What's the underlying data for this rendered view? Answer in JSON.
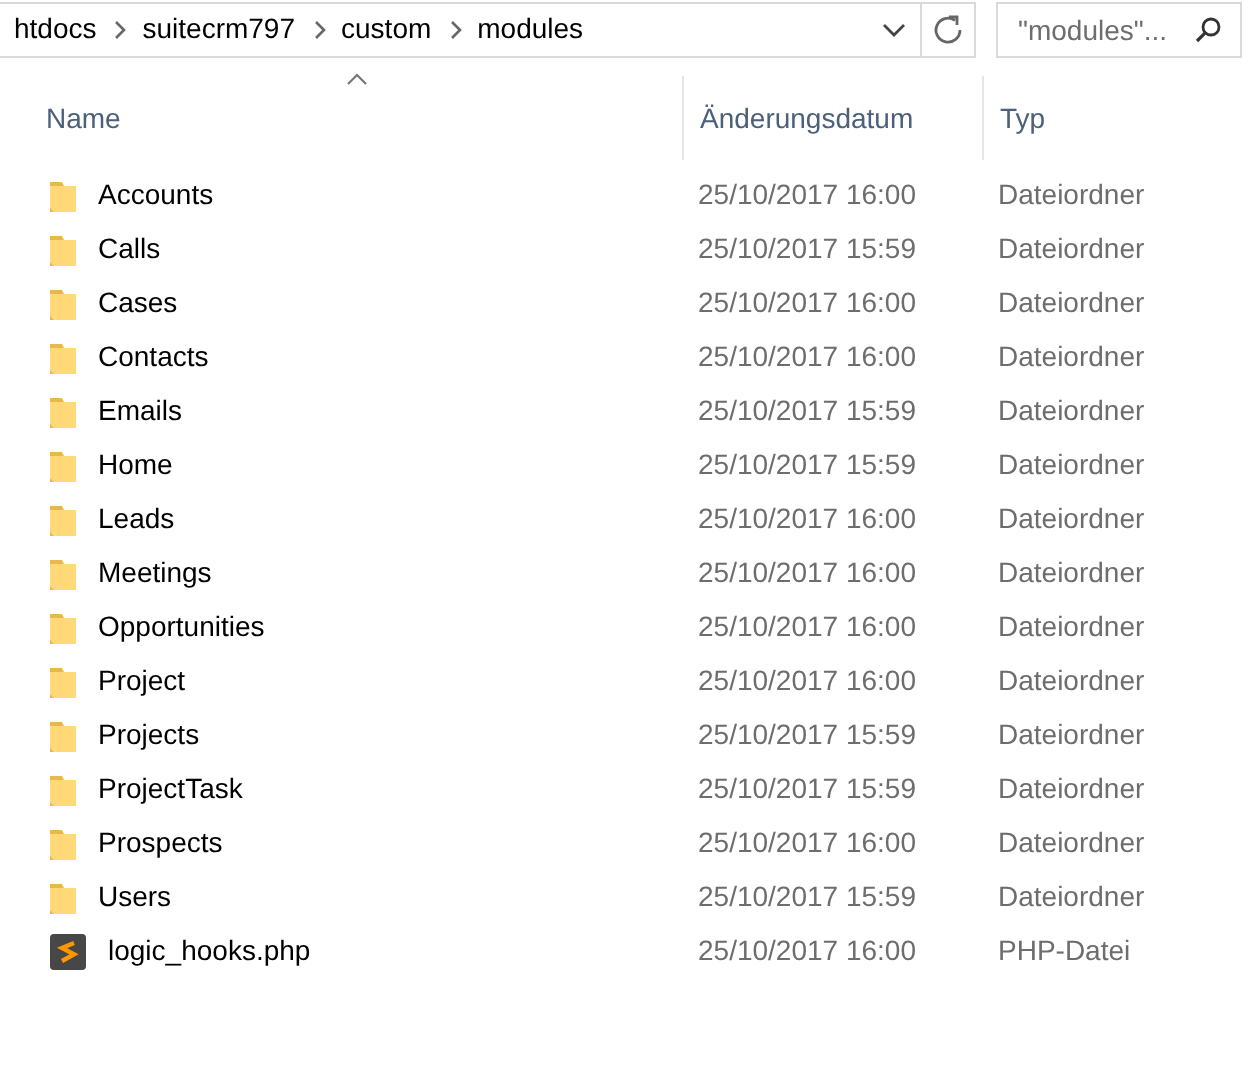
{
  "address_bar": {
    "path": [
      "htdocs",
      "suitecrm797",
      "custom",
      "modules"
    ]
  },
  "search": {
    "placeholder": "\"modules\"..."
  },
  "columns": [
    {
      "label": "Name",
      "sorted": true
    },
    {
      "label": "Änderungsdatum",
      "sorted": false
    },
    {
      "label": "Typ",
      "sorted": false
    }
  ],
  "files": [
    {
      "kind": "folder",
      "name": "Accounts",
      "modified": "25/10/2017 16:00",
      "type": "Dateiordner"
    },
    {
      "kind": "folder",
      "name": "Calls",
      "modified": "25/10/2017 15:59",
      "type": "Dateiordner"
    },
    {
      "kind": "folder",
      "name": "Cases",
      "modified": "25/10/2017 16:00",
      "type": "Dateiordner"
    },
    {
      "kind": "folder",
      "name": "Contacts",
      "modified": "25/10/2017 16:00",
      "type": "Dateiordner"
    },
    {
      "kind": "folder",
      "name": "Emails",
      "modified": "25/10/2017 15:59",
      "type": "Dateiordner"
    },
    {
      "kind": "folder",
      "name": "Home",
      "modified": "25/10/2017 15:59",
      "type": "Dateiordner"
    },
    {
      "kind": "folder",
      "name": "Leads",
      "modified": "25/10/2017 16:00",
      "type": "Dateiordner"
    },
    {
      "kind": "folder",
      "name": "Meetings",
      "modified": "25/10/2017 16:00",
      "type": "Dateiordner"
    },
    {
      "kind": "folder",
      "name": "Opportunities",
      "modified": "25/10/2017 16:00",
      "type": "Dateiordner"
    },
    {
      "kind": "folder",
      "name": "Project",
      "modified": "25/10/2017 16:00",
      "type": "Dateiordner"
    },
    {
      "kind": "folder",
      "name": "Projects",
      "modified": "25/10/2017 15:59",
      "type": "Dateiordner"
    },
    {
      "kind": "folder",
      "name": "ProjectTask",
      "modified": "25/10/2017 15:59",
      "type": "Dateiordner"
    },
    {
      "kind": "folder",
      "name": "Prospects",
      "modified": "25/10/2017 16:00",
      "type": "Dateiordner"
    },
    {
      "kind": "folder",
      "name": "Users",
      "modified": "25/10/2017 15:59",
      "type": "Dateiordner"
    },
    {
      "kind": "php",
      "name": "logic_hooks.php",
      "modified": "25/10/2017 16:00",
      "type": "PHP-Datei"
    }
  ]
}
